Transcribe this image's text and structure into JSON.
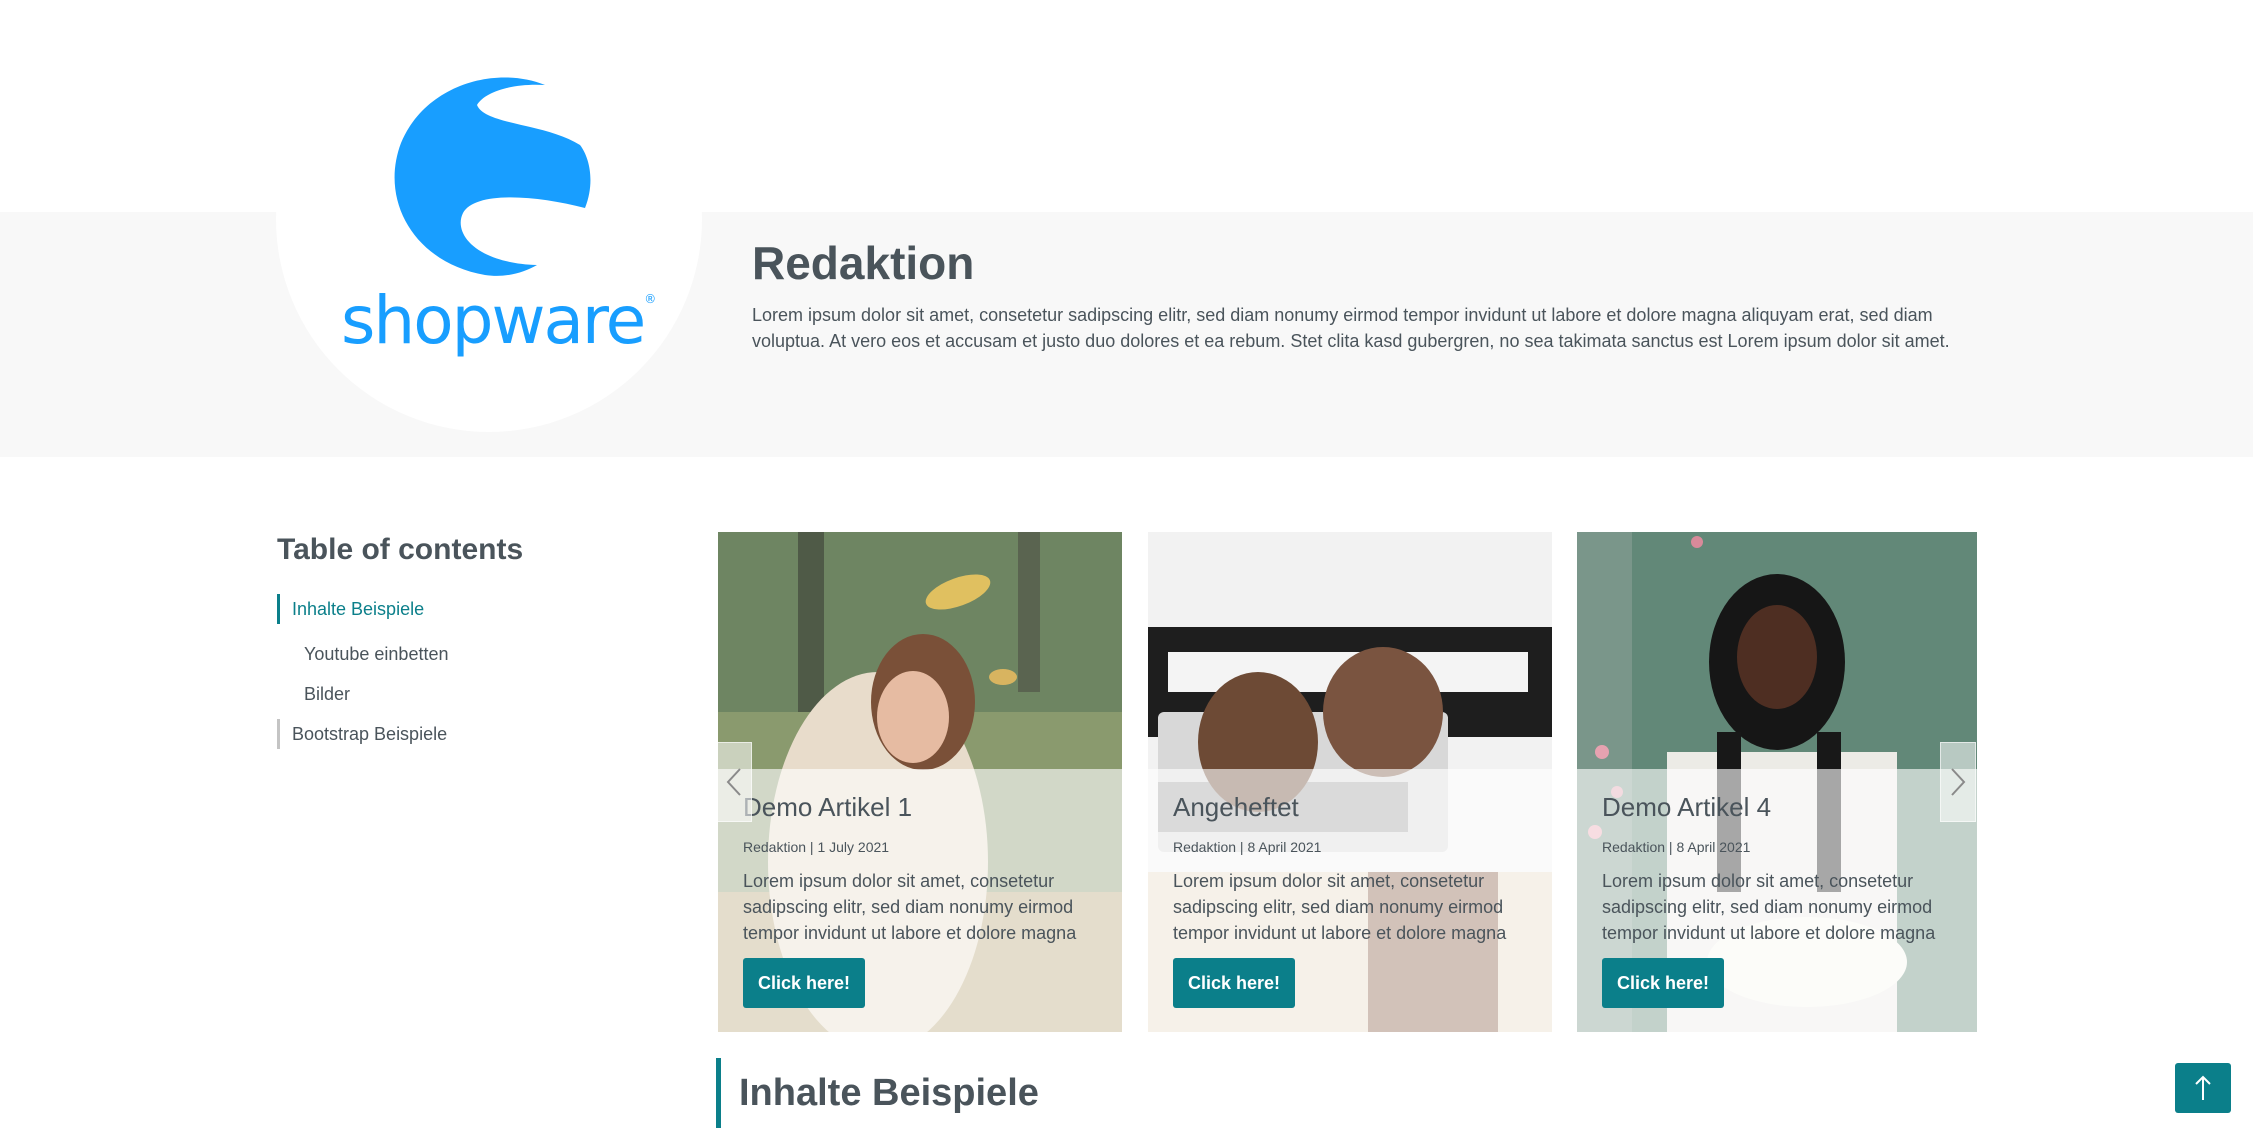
{
  "author": {
    "logo_text": "shopware",
    "logo_registered": "®",
    "name": "Redaktion",
    "bio": "Lorem ipsum dolor sit amet, consetetur sadipscing elitr, sed diam nonumy eirmod tempor invidunt ut labore et dolore magna aliquyam erat, sed diam voluptua. At vero eos et accusam et justo duo dolores et ea rebum. Stet clita kasd gubergren, no sea takimata sanctus est Lorem ipsum dolor sit amet."
  },
  "toc": {
    "title": "Table of contents",
    "items": [
      {
        "label": "Inhalte Beispiele",
        "level": 1,
        "active": true
      },
      {
        "label": "Youtube einbetten",
        "level": 2
      },
      {
        "label": "Bilder",
        "level": 2
      },
      {
        "label": "Bootstrap Beispiele",
        "level": 1
      }
    ]
  },
  "slider": {
    "prev_icon": "chevron-left-icon",
    "next_icon": "chevron-right-icon",
    "cards": [
      {
        "title": "Demo Artikel 1",
        "meta": "Redaktion | 1 July 2021",
        "text": "Lorem ipsum dolor sit amet, consetetur sadipscing elitr, sed diam nonumy eirmod tempor invidunt ut labore et dolore magna",
        "button": "Click here!"
      },
      {
        "title": "Angeheftet",
        "meta": "Redaktion | 8 April 2021",
        "text": "Lorem ipsum dolor sit amet, consetetur sadipscing elitr, sed diam nonumy eirmod tempor invidunt ut labore et dolore magna",
        "button": "Click here!"
      },
      {
        "title": "Demo Artikel 4",
        "meta": "Redaktion | 8 April 2021",
        "text": "Lorem ipsum dolor sit amet, consetetur sadipscing elitr, sed diam nonumy eirmod tempor invidunt ut labore et dolore magna",
        "button": "Click here!"
      }
    ]
  },
  "section": {
    "heading": "Inhalte Beispiele"
  },
  "scroll_top": {
    "icon": "arrow-up-icon"
  },
  "colors": {
    "accent": "#0b7f8a",
    "brand": "#189eff",
    "text": "#4a545b",
    "band": "#f8f8f8"
  }
}
